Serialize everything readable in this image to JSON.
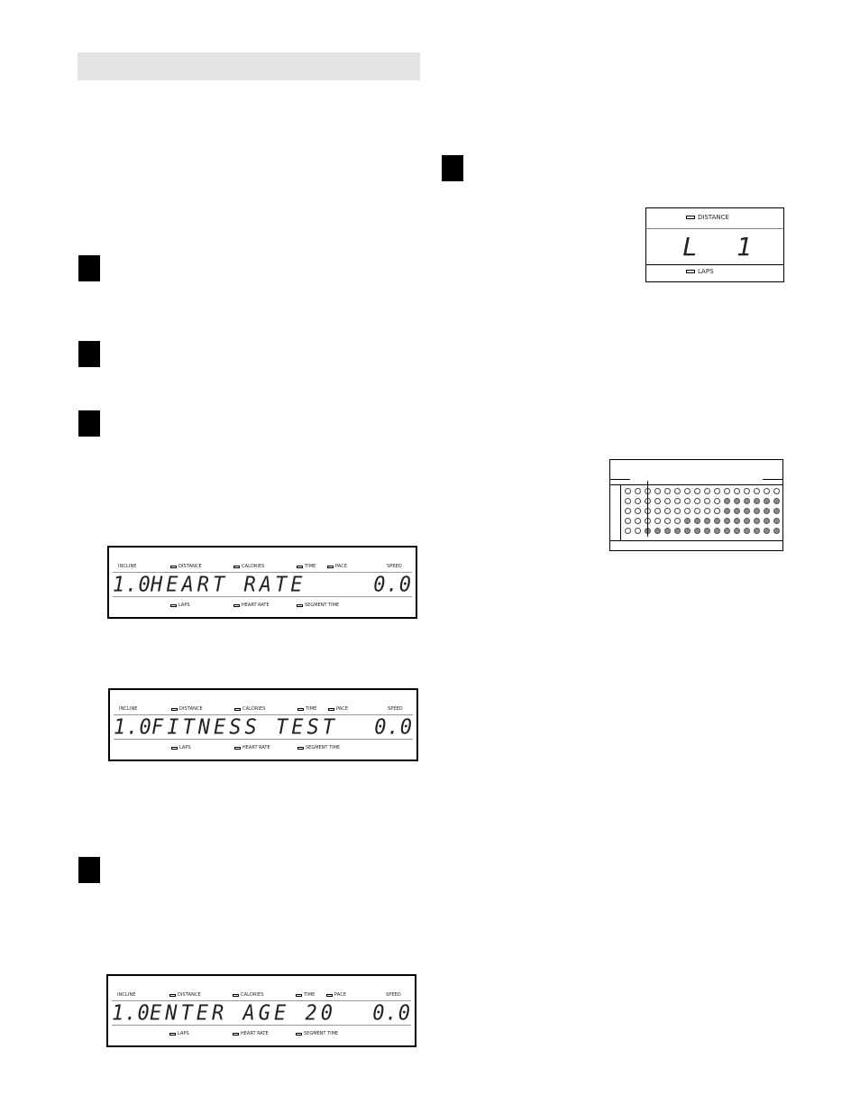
{
  "page": {
    "header_bar_color": "#e3e3e3",
    "steps": [
      {
        "id": "step-1"
      },
      {
        "id": "step-2"
      },
      {
        "id": "step-3"
      },
      {
        "id": "step-4"
      },
      {
        "id": "step-5"
      }
    ]
  },
  "console_labels": {
    "top": [
      "INCLINE",
      "DISTANCE",
      "CALORIES",
      "TIME",
      "PACE",
      "SPEED"
    ],
    "bottom": [
      "LAPS",
      "HEART RATE",
      "SEGMENT TIME"
    ]
  },
  "displays": [
    {
      "incline": "1.0",
      "message": "HEART RATE",
      "speed": "0.0"
    },
    {
      "incline": "1.0",
      "message": "FITNESS TEST",
      "speed": "0.0"
    },
    {
      "incline": "1.0",
      "message": "ENTER AGE 20",
      "speed": "0.0"
    }
  ],
  "laps_display": {
    "top_label": "DISTANCE",
    "bottom_label": "LAPS",
    "left_char": "L",
    "right_char": "1"
  },
  "matrix_display": {
    "columns": 16,
    "rows": 5,
    "fill_start_column_by_row": [
      null,
      11,
      11,
      7,
      3
    ],
    "marker_column": 3
  }
}
